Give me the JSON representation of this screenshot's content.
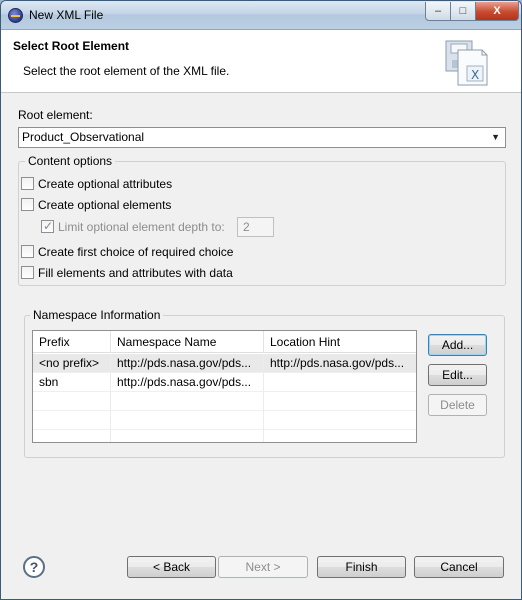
{
  "window": {
    "title": "New XML File",
    "controls": {
      "minimize": "–",
      "maximize": "□",
      "close": "X"
    }
  },
  "banner": {
    "title": "Select Root Element",
    "description": "Select the root element of the XML file.",
    "graphic_icon": "xml-file-wizard-icon",
    "graphic_letter": "X"
  },
  "root_element": {
    "label": "Root element:",
    "value": "Product_Observational"
  },
  "content_options": {
    "legend": "Content options",
    "items": [
      {
        "label": "Create optional attributes",
        "checked": false,
        "enabled": true
      },
      {
        "label": "Create optional elements",
        "checked": false,
        "enabled": true
      },
      {
        "label": "Limit optional element depth to:",
        "checked": true,
        "enabled": false,
        "depth_value": "2"
      },
      {
        "label": "Create first choice of required choice",
        "checked": false,
        "enabled": true
      },
      {
        "label": "Fill elements and attributes with data",
        "checked": false,
        "enabled": true
      }
    ]
  },
  "namespace": {
    "legend": "Namespace Information",
    "columns": [
      "Prefix",
      "Namespace Name",
      "Location Hint"
    ],
    "rows": [
      {
        "prefix": "<no prefix>",
        "namespace": "http://pds.nasa.gov/pds...",
        "location": "http://pds.nasa.gov/pds..."
      },
      {
        "prefix": "sbn",
        "namespace": "http://pds.nasa.gov/pds...",
        "location": ""
      }
    ],
    "buttons": {
      "add": "Add...",
      "edit": "Edit...",
      "delete": "Delete"
    }
  },
  "footer": {
    "help": "?",
    "back": "< Back",
    "next": "Next >",
    "finish": "Finish",
    "cancel": "Cancel"
  },
  "colors": {
    "title_bar": "#c4d5e7",
    "close_button": "#c94a2f",
    "default_button_border": "#3c7fb1"
  }
}
